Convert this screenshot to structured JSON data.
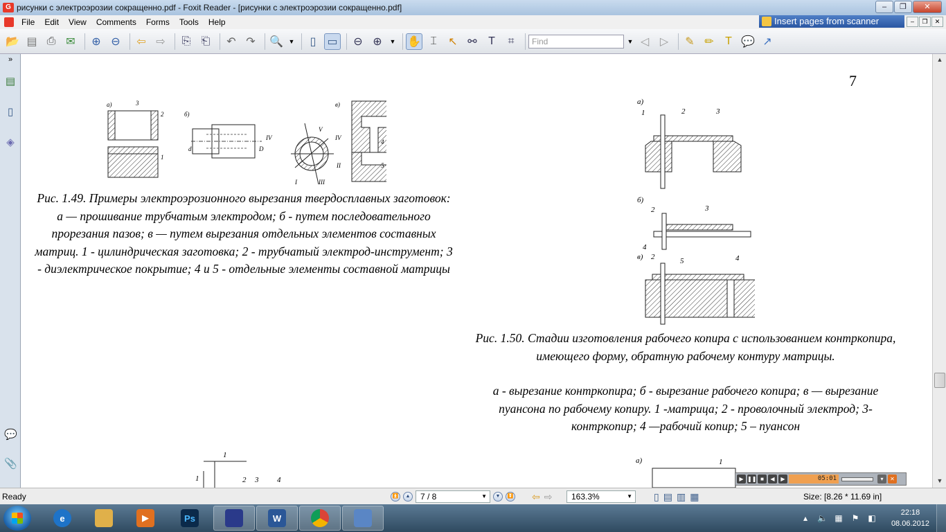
{
  "window": {
    "title": "рисунки с электроэрозии сокращенно.pdf - Foxit Reader - [рисунки с электроэрозии сокращенно.pdf]",
    "scanner_banner": "Insert pages from scanner"
  },
  "menu": [
    "File",
    "Edit",
    "View",
    "Comments",
    "Forms",
    "Tools",
    "Help"
  ],
  "toolbar": {
    "find_placeholder": "Find"
  },
  "page": {
    "number": "7",
    "fig149_caption": "Рис. 1.49. Примеры электроэрозионного вырезания твердосплавных заготовок: а — прошивание трубчатым электродом; б - путем последовательного прорезания пазов; в — путем вырезания отдельных элементов составных матриц. 1 - цилиндрическая заготовка; 2 - трубчатый электрод-инструмент; 3 - диэлектрическое покрытие; 4 и 5 - отдельные элементы составной матрицы",
    "fig150_caption_title": "Рис. 1.50. Стадии изготовления рабочего копира с использованием контркопира, имеющего форму, обратную рабочему контуру матрицы.",
    "fig150_caption_body": "а - вырезание контркопира; б - вырезание рабочего копира; в — вырезание пуансона по рабочему копиру. 1 -матрица; 2 - проволочный электрод; 3- контркопир; 4 —рабочий копир; 5 – пуансон",
    "fig149_labels": {
      "a": "а)",
      "b": "б)",
      "v": "в)",
      "n1": "1",
      "n2": "2",
      "n3": "3",
      "n4": "4",
      "n5": "5",
      "d": "d",
      "D": "D",
      "r1": "I",
      "r2": "II",
      "r3": "III",
      "r4": "IV",
      "r5": "V"
    },
    "fig150_labels": {
      "a": "а)",
      "b": "б)",
      "v": "в)",
      "n1": "1",
      "n2": "2",
      "n3": "3",
      "n4": "4",
      "n5": "5"
    },
    "fig151_labels": {
      "n1": "1",
      "n2": "2",
      "n3": "3",
      "n4": "4",
      "a": "а)"
    }
  },
  "player": {
    "time": "05:01"
  },
  "status": {
    "ready": "Ready",
    "page_indicator": "7 / 8",
    "zoom": "163.3%",
    "size": "Size: [8.26 * 11.69 in]"
  },
  "taskbar": {
    "apps": [
      {
        "name": "internet-explorer",
        "glyph": "e",
        "color": "#1e73c8"
      },
      {
        "name": "file-explorer",
        "glyph": "",
        "color": "#e0b04a"
      },
      {
        "name": "media-player",
        "glyph": "▶",
        "color": "#e07020"
      },
      {
        "name": "photoshop",
        "glyph": "Ps",
        "color": "#0b2a4a"
      },
      {
        "name": "save-disk",
        "glyph": "",
        "color": "#2a3a8a"
      },
      {
        "name": "word",
        "glyph": "W",
        "color": "#2b5797"
      },
      {
        "name": "chrome",
        "glyph": "",
        "color": "#db4437"
      },
      {
        "name": "foxit-reader",
        "glyph": "",
        "color": "#5a86c5"
      }
    ],
    "time": "22:18",
    "date": "08.06.2012"
  }
}
